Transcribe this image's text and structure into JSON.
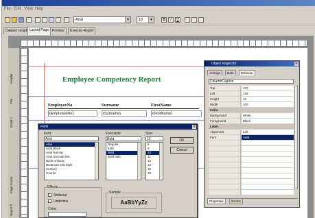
{
  "menubar": {
    "items": [
      "File",
      "Edit",
      "View",
      "Help"
    ]
  },
  "toolbar": {
    "font_name": "Arial",
    "font_size": "10",
    "bold_label": "B",
    "italic_label": "I",
    "underline_label": "U"
  },
  "tabs": [
    "Dataset Graph",
    "Layout Page",
    "Preview",
    "Execute Report"
  ],
  "bands": [
    "Header",
    "Title",
    "Detail 1",
    "Page Footer",
    "Report ft"
  ],
  "report": {
    "title": "Employee Competency Report",
    "columns": [
      {
        "header": "EmployeeNo",
        "field": "{EmployeeNo}"
      },
      {
        "header": "Surname",
        "field": "{Surname}"
      },
      {
        "header": "FirstName",
        "field": "{FirstName}"
      }
    ]
  },
  "font_dialog": {
    "title": "Font",
    "font_label": "Font:",
    "font_value": "Arial",
    "font_items": [
      "Arial",
      "Arial Black",
      "Arial Narrow",
      "Arial Unicode MS",
      "Book Antiqua",
      "Bookman Old Style",
      "Century",
      "Courier"
    ],
    "selected_font_index": 0,
    "style_label": "Font style:",
    "style_value": "Bold",
    "style_items": [
      "Regular",
      "Italic",
      "Bold",
      "Bold Italic"
    ],
    "selected_style_index": 2,
    "size_label": "Size:",
    "size_value": "10",
    "size_items": [
      "8",
      "9",
      "10",
      "11",
      "12",
      "14",
      "16",
      "18"
    ],
    "selected_size_index": 2,
    "ok_label": "OK",
    "cancel_label": "Cancel",
    "effects_label": "Effects",
    "strikeout_label": "Strikeout",
    "underline_label": "Underline",
    "color_label": "Color:",
    "sample_label": "Sample",
    "sample_text": "AaBbYyZz"
  },
  "properties": {
    "title": "Object Inspector",
    "tabs": [
      "Arrange",
      "Data",
      "Behavior"
    ],
    "object": "ColumnCaption",
    "rows": [
      {
        "name": "Top",
        "value": "100"
      },
      {
        "name": "Left",
        "value": "125"
      },
      {
        "name": "Height",
        "value": "16"
      },
      {
        "name": "Width",
        "value": "100"
      }
    ],
    "cat_color": "Color",
    "color_rows": [
      {
        "name": "Background",
        "value": "White"
      },
      {
        "name": "Foreground",
        "value": "Black"
      }
    ],
    "cat_label": "Label",
    "label_rows": [
      {
        "name": "Alignment",
        "value": "Left"
      },
      {
        "name": "Font",
        "value": "Arial"
      }
    ],
    "bottom_tabs": [
      "Properties",
      "Events"
    ]
  },
  "colors": {
    "title_green": "#178a2e",
    "selection_blue": "#0a246a"
  }
}
